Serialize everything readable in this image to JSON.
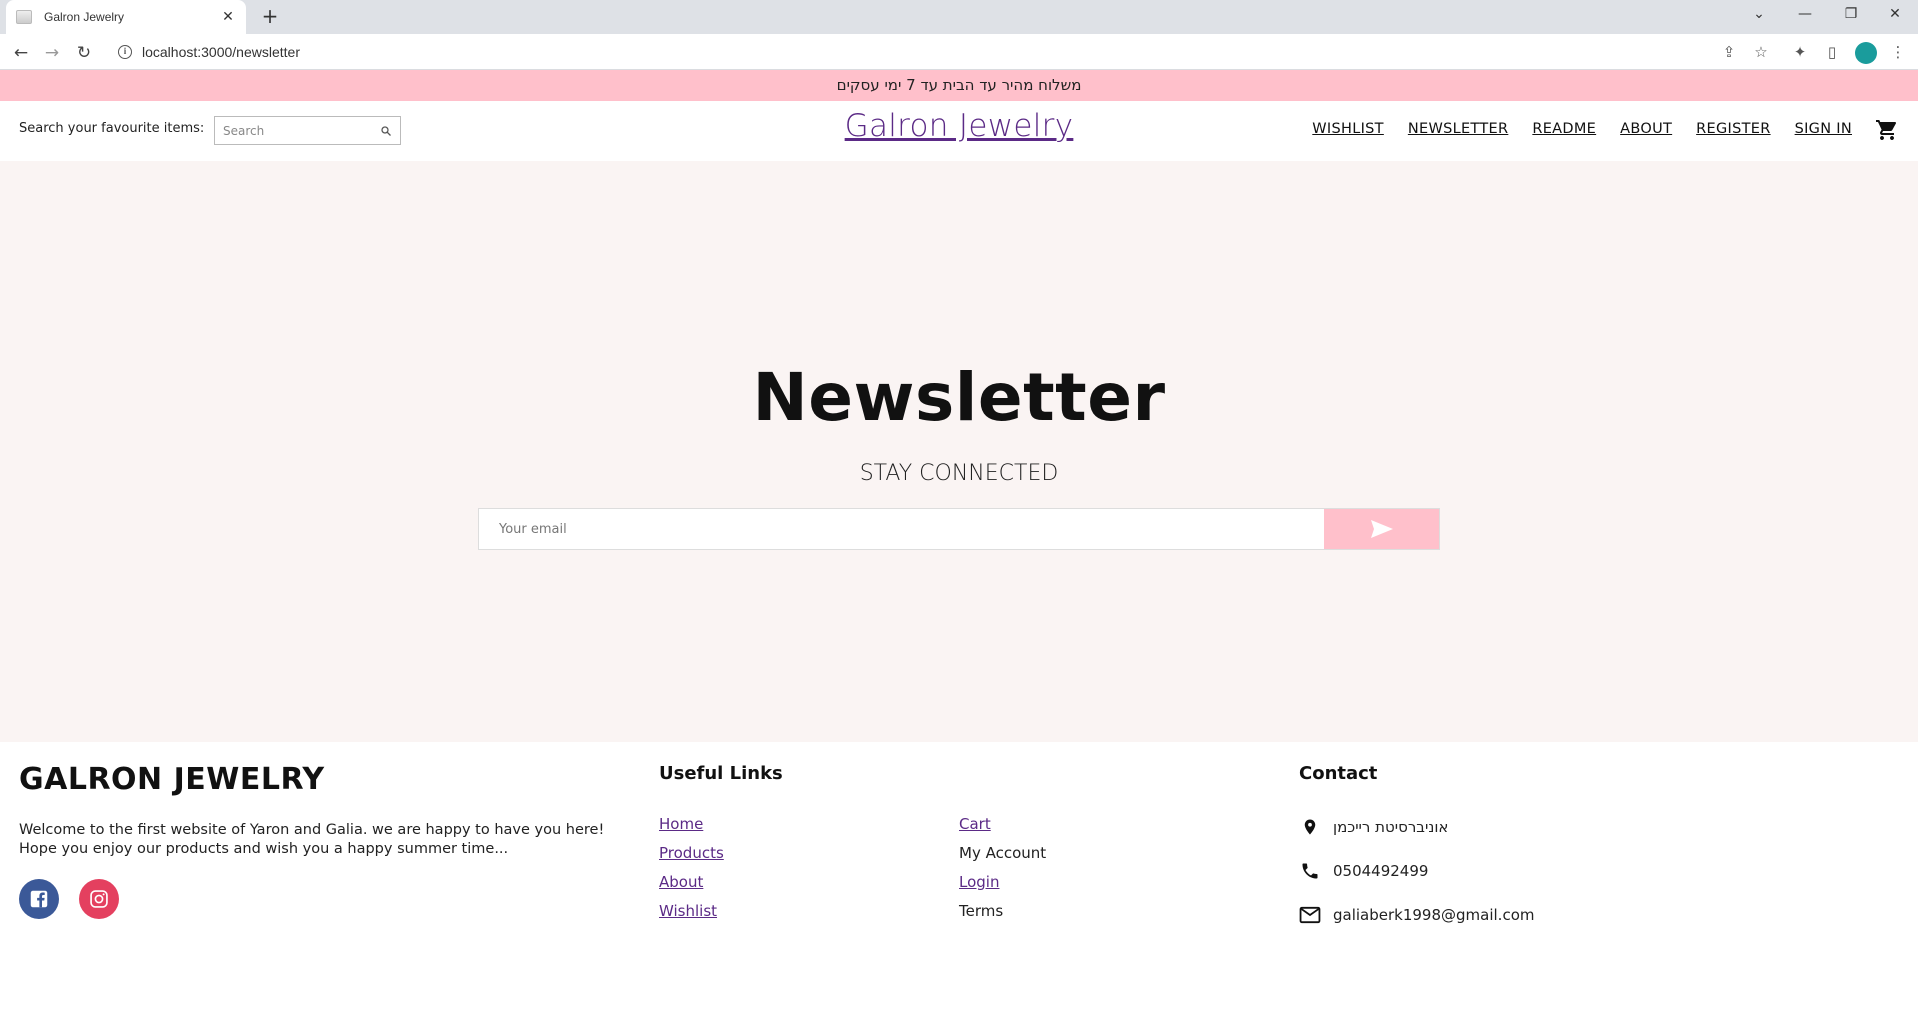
{
  "browser": {
    "tab_title": "Galron Jewelry",
    "url": "localhost:3000/newsletter"
  },
  "promo": {
    "text": "משלוח מהיר עד הבית עד 7 ימי עסקים"
  },
  "header": {
    "search_label": "Search your favourite items:",
    "search_placeholder": "Search",
    "brand": "Galron Jewelry",
    "nav": [
      "WISHLIST",
      "NEWSLETTER",
      "README",
      "ABOUT",
      "REGISTER",
      "SIGN IN"
    ]
  },
  "newsletter": {
    "title": "Newsletter",
    "subtitle": "STAY CONNECTED",
    "email_placeholder": "Your email"
  },
  "footer": {
    "brand": "GALRON JEWELRY",
    "desc_line1": "Welcome to the first website of Yaron and Galia. we are happy to have you here!",
    "desc_line2": "Hope you enjoy our products and wish you a happy summer time...",
    "useful_links_title": "Useful Links",
    "links_col1": [
      "Home",
      "Products",
      "About",
      "Wishlist"
    ],
    "links_col2": [
      "Cart",
      "My Account",
      "Login",
      "Terms"
    ],
    "contact_title": "Contact",
    "address": "אוניברסיטת רייכמן",
    "phone": "0504492499",
    "email": "galiaberk1998@gmail.com"
  },
  "colors": {
    "promo_bg": "#ffc0cb",
    "brand": "#5b2a86",
    "main_bg": "#faf4f3",
    "facebook": "#3b5998",
    "instagram": "#e4405f"
  }
}
